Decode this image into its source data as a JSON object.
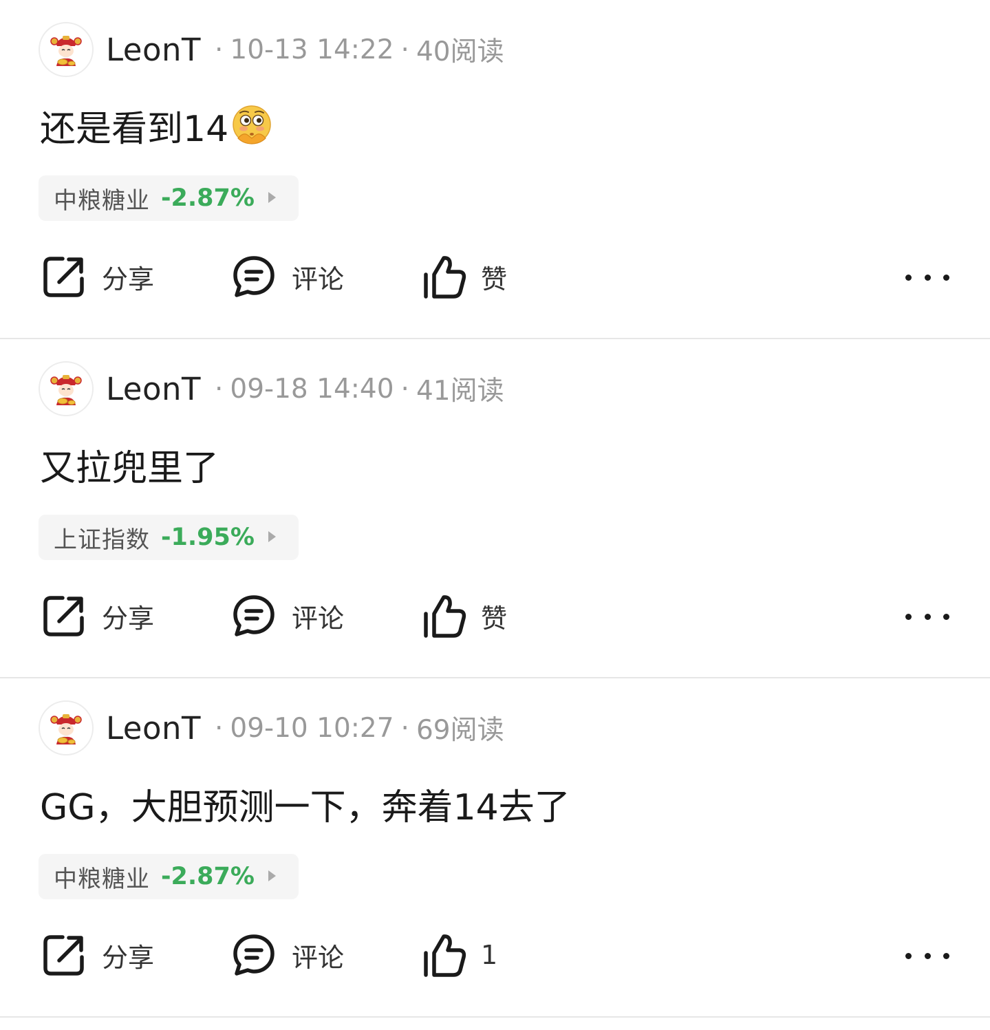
{
  "posts": [
    {
      "author": "LeonT",
      "time": "10-13 14:22",
      "reads": "40阅读",
      "content": "还是看到14",
      "content_emoji": "flushed-face-icon",
      "stock": {
        "name": "中粮糖业",
        "change": "-2.87%"
      },
      "actions": {
        "share": "分享",
        "comment": "评论",
        "like": "赞"
      }
    },
    {
      "author": "LeonT",
      "time": "09-18 14:40",
      "reads": "41阅读",
      "content": "又拉兜里了",
      "stock": {
        "name": "上证指数",
        "change": "-1.95%"
      },
      "actions": {
        "share": "分享",
        "comment": "评论",
        "like": "赞"
      }
    },
    {
      "author": "LeonT",
      "time": "09-10 10:27",
      "reads": "69阅读",
      "content": "GG，大胆预测一下，奔着14去了",
      "stock": {
        "name": "中粮糖业",
        "change": "-2.87%"
      },
      "actions": {
        "share": "分享",
        "comment": "评论",
        "like": "1"
      }
    }
  ],
  "colors": {
    "stock_down": "#3bab5a",
    "meta": "#999999",
    "text": "#1a1a1a"
  },
  "icons": [
    "avatar-caishen-icon",
    "share-icon",
    "comment-icon",
    "thumbs-up-icon",
    "more-icon"
  ]
}
